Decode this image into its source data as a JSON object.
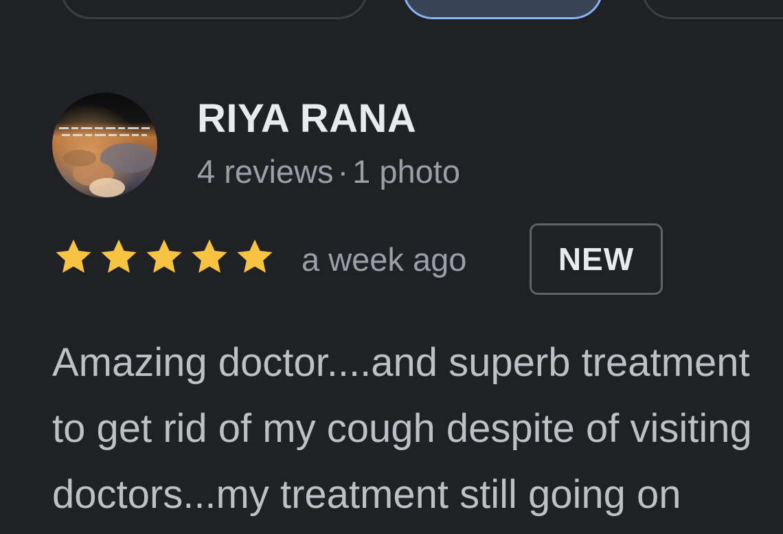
{
  "reviewer": {
    "name": "RIYA RANA",
    "reviews_count": "4 reviews",
    "separator": "·",
    "photos_count": "1 photo",
    "avatar_icon": "profile-photo"
  },
  "rating": {
    "stars": 5,
    "max_stars": 5,
    "star_color": "#f6c343",
    "time": "a week ago",
    "badge": "NEW"
  },
  "review": {
    "lines": [
      "Amazing doctor....and superb treatment",
      "to get rid of my cough despite of visiting",
      "doctors...my treatment still going on"
    ]
  },
  "colors": {
    "background": "#202124",
    "active_chip_border": "#8ab4f8",
    "active_chip_fill": "#394457"
  }
}
